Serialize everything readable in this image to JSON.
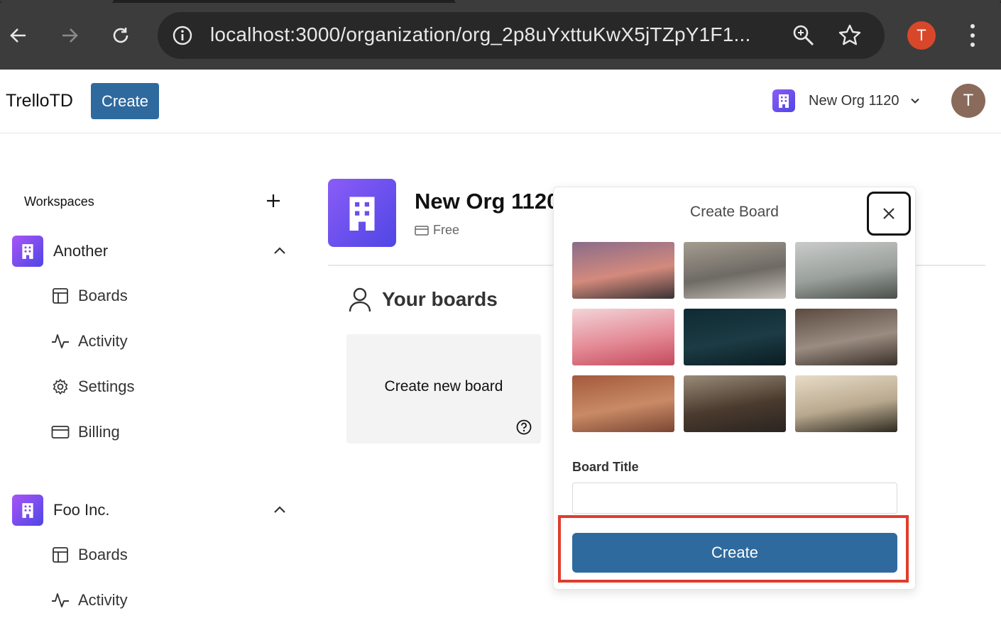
{
  "browser": {
    "url": "localhost:3000/organization/org_2p8uYxttuKwX5jTZpY1F1...",
    "profile_initial": "T",
    "icons": [
      "back-icon",
      "forward-icon",
      "reload-icon",
      "site-info-icon",
      "zoom-icon",
      "bookmark-star-icon",
      "browser-menu-icon"
    ]
  },
  "header": {
    "brand": "TrelloTD",
    "create_label": "Create",
    "org_name": "New Org 1120",
    "avatar_initial": "T"
  },
  "sidebar": {
    "title": "Workspaces",
    "workspaces": [
      {
        "name": "Another",
        "items": [
          {
            "label": "Boards",
            "icon": "boards-icon"
          },
          {
            "label": "Activity",
            "icon": "activity-icon"
          },
          {
            "label": "Settings",
            "icon": "settings-icon"
          },
          {
            "label": "Billing",
            "icon": "billing-icon"
          }
        ]
      },
      {
        "name": "Foo Inc.",
        "items": [
          {
            "label": "Boards",
            "icon": "boards-icon"
          },
          {
            "label": "Activity",
            "icon": "activity-icon"
          }
        ]
      }
    ]
  },
  "main": {
    "org_title": "New Org 1120",
    "plan": "Free",
    "section_title": "Your boards",
    "create_tile_label": "Create new board"
  },
  "popover": {
    "title": "Create Board",
    "field_label": "Board Title",
    "input_value": "",
    "submit_label": "Create",
    "image_options": [
      {
        "scene": "pink-sunset-mountains",
        "colors": [
          "#8a6c8a",
          "#d38a7c",
          "#3a3234"
        ]
      },
      {
        "scene": "metallic-building-facade",
        "colors": [
          "#a49c90",
          "#6e6a64",
          "#c8c3bb"
        ]
      },
      {
        "scene": "foggy-pier",
        "colors": [
          "#c9cbca",
          "#9aa09c",
          "#4a4f4c"
        ]
      },
      {
        "scene": "pink-cubes",
        "colors": [
          "#f2d4d8",
          "#e48a96",
          "#c44a5c"
        ]
      },
      {
        "scene": "aerial-boats-dark-water",
        "colors": [
          "#0f2a32",
          "#1c3b44",
          "#0a1c22"
        ]
      },
      {
        "scene": "street-puddle-splash",
        "colors": [
          "#5b4a40",
          "#9a8c80",
          "#3a302a"
        ]
      },
      {
        "scene": "canyon-road",
        "colors": [
          "#a25a3c",
          "#c98a66",
          "#7a4632"
        ]
      },
      {
        "scene": "mountain-lake-reflection",
        "colors": [
          "#9a8a78",
          "#4a3a2e",
          "#2a2420"
        ]
      },
      {
        "scene": "coastal-cliffs-sunset",
        "colors": [
          "#e8dcc6",
          "#b8a88e",
          "#2e2a20"
        ]
      }
    ]
  },
  "colors": {
    "primary": "#2f6a9e",
    "org_gradient_start": "#8b5cf6",
    "org_gradient_end": "#4f46e5",
    "highlight": "#e03c2c"
  }
}
